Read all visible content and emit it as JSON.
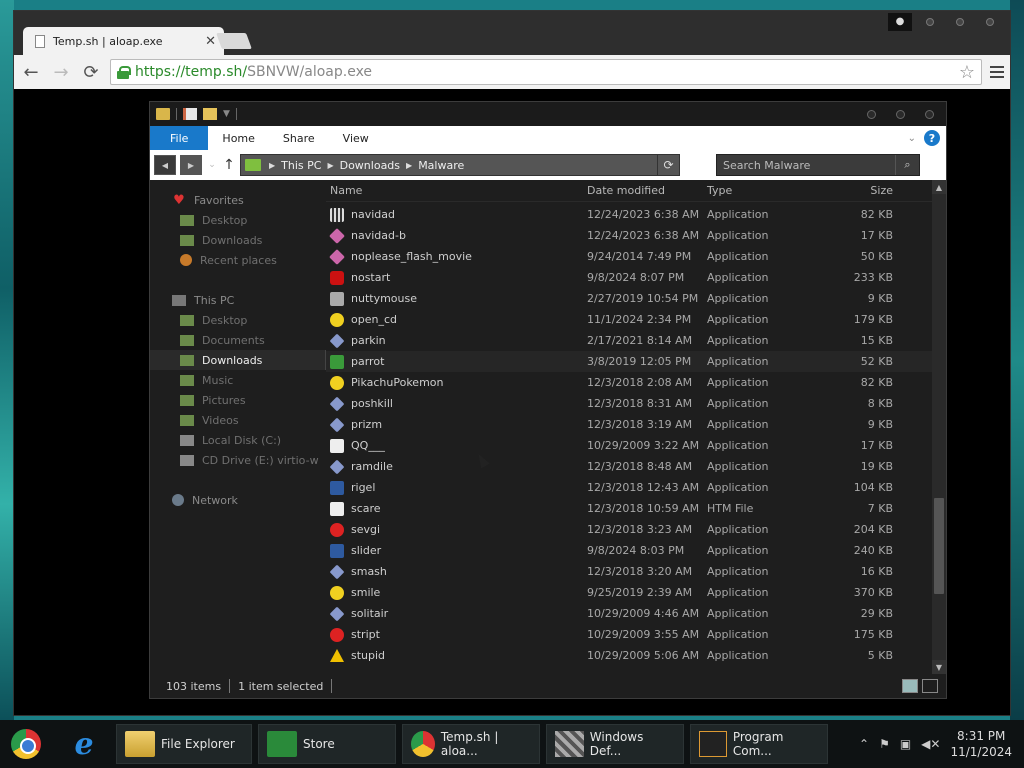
{
  "browser": {
    "tab_title": "Temp.sh | aloap.exe",
    "tab_close": "✕",
    "url_host": "https://temp.sh/",
    "url_path": "SBNVW/aloap.exe"
  },
  "explorer": {
    "ribbon_tabs": [
      "File",
      "Home",
      "Share",
      "View"
    ],
    "breadcrumb": [
      "This PC",
      "Downloads",
      "Malware"
    ],
    "search_placeholder": "Search Malware",
    "columns": {
      "name": "Name",
      "date": "Date modified",
      "type": "Type",
      "size": "Size"
    },
    "nav": {
      "favorites_label": "Favorites",
      "favorites": [
        "Desktop",
        "Downloads",
        "Recent places"
      ],
      "thispc_label": "This PC",
      "thispc": [
        "Desktop",
        "Documents",
        "Downloads",
        "Music",
        "Pictures",
        "Videos",
        "Local Disk (C:)",
        "CD Drive (E:) virtio-w"
      ],
      "network_label": "Network"
    },
    "files": [
      {
        "name": "navidad",
        "date": "12/24/2023 6:38 AM",
        "type": "Application",
        "size": "82 KB",
        "icon": "bar-icon"
      },
      {
        "name": "navidad-b",
        "date": "12/24/2023 6:38 AM",
        "type": "Application",
        "size": "17 KB",
        "icon": "pink-diamond-icon"
      },
      {
        "name": "noplease_flash_movie",
        "date": "9/24/2014 7:49 PM",
        "type": "Application",
        "size": "50 KB",
        "icon": "pink-diamond-icon"
      },
      {
        "name": "nostart",
        "date": "9/8/2024 8:07 PM",
        "type": "Application",
        "size": "233 KB",
        "icon": "stop-icon"
      },
      {
        "name": "nuttymouse",
        "date": "2/27/2019 10:54 PM",
        "type": "Application",
        "size": "9 KB",
        "icon": "mouse-icon"
      },
      {
        "name": "open_cd",
        "date": "11/1/2024 2:34 PM",
        "type": "Application",
        "size": "179 KB",
        "icon": "cd-icon"
      },
      {
        "name": "parkin",
        "date": "2/17/2021 8:14 AM",
        "type": "Application",
        "size": "15 KB",
        "icon": "diamond-icon"
      },
      {
        "name": "parrot",
        "date": "3/8/2019 12:05 PM",
        "type": "Application",
        "size": "52 KB",
        "icon": "parrot-icon"
      },
      {
        "name": "PikachuPokemon",
        "date": "12/3/2018 2:08 AM",
        "type": "Application",
        "size": "82 KB",
        "icon": "pikachu-icon"
      },
      {
        "name": "poshkill",
        "date": "12/3/2018 8:31 AM",
        "type": "Application",
        "size": "8 KB",
        "icon": "diamond-icon"
      },
      {
        "name": "prizm",
        "date": "12/3/2018 3:19 AM",
        "type": "Application",
        "size": "9 KB",
        "icon": "diamond-icon"
      },
      {
        "name": "QQ___",
        "date": "10/29/2009 3:22 AM",
        "type": "Application",
        "size": "17 KB",
        "icon": "qq-icon"
      },
      {
        "name": "ramdile",
        "date": "12/3/2018 8:48 AM",
        "type": "Application",
        "size": "19 KB",
        "icon": "diamond-icon"
      },
      {
        "name": "rigel",
        "date": "12/3/2018 12:43 AM",
        "type": "Application",
        "size": "104 KB",
        "icon": "window-icon"
      },
      {
        "name": "scare",
        "date": "12/3/2018 10:59 AM",
        "type": "HTM File",
        "size": "7 KB",
        "icon": "document-icon"
      },
      {
        "name": "sevgi",
        "date": "12/3/2018 3:23 AM",
        "type": "Application",
        "size": "204 KB",
        "icon": "heart-icon"
      },
      {
        "name": "slider",
        "date": "9/8/2024 8:03 PM",
        "type": "Application",
        "size": "240 KB",
        "icon": "slider-icon"
      },
      {
        "name": "smash",
        "date": "12/3/2018 3:20 AM",
        "type": "Application",
        "size": "16 KB",
        "icon": "diamond-icon"
      },
      {
        "name": "smile",
        "date": "9/25/2019 2:39 AM",
        "type": "Application",
        "size": "370 KB",
        "icon": "smiley-icon"
      },
      {
        "name": "solitair",
        "date": "10/29/2009 4:46 AM",
        "type": "Application",
        "size": "29 KB",
        "icon": "diamond-icon"
      },
      {
        "name": "stript",
        "date": "10/29/2009 3:55 AM",
        "type": "Application",
        "size": "175 KB",
        "icon": "stripe-icon"
      },
      {
        "name": "stupid",
        "date": "10/29/2009 5:06 AM",
        "type": "Application",
        "size": "5 KB",
        "icon": "warning-icon"
      }
    ],
    "status_items": "103 items",
    "status_selected": "1 item selected"
  },
  "taskbar": {
    "items": [
      "File Explorer",
      "Store",
      "Temp.sh | aloa...",
      "Windows Def...",
      "Program Com..."
    ],
    "time": "8:31 PM",
    "date": "11/1/2024"
  }
}
